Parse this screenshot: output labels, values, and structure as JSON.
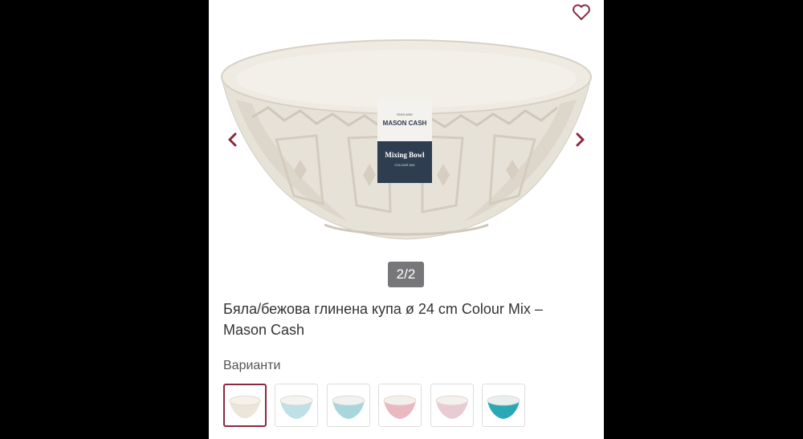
{
  "gallery": {
    "counter": "2/2",
    "label": {
      "brand_top": "ENGLAND",
      "brand": "MASON CASH",
      "product": "Mixing Bowl",
      "line": "COLOUR MIX"
    },
    "icons": {
      "favorite": "heart-icon",
      "prev": "chevron-left-icon",
      "next": "chevron-right-icon"
    }
  },
  "product": {
    "title": "Бяла/бежова глинена купа ø 24 cm Colour Mix – Mason Cash"
  },
  "variants": {
    "label": "Варианти",
    "items": [
      {
        "color": "#ece5d9",
        "rim": "#f6f1e9",
        "selected": true
      },
      {
        "color": "#bfe0e6",
        "rim": "#f3f3f0",
        "selected": false
      },
      {
        "color": "#a8d6dc",
        "rim": "#eef2f1",
        "selected": false
      },
      {
        "color": "#eab9c0",
        "rim": "#f4efea",
        "selected": false
      },
      {
        "color": "#e9cbd3",
        "rim": "#f5efed",
        "selected": false
      },
      {
        "color": "#2aa8b6",
        "rim": "#e9efef",
        "selected": false
      }
    ]
  },
  "colors": {
    "accent": "#8b2a3e",
    "counter_bg": "#77777a"
  }
}
